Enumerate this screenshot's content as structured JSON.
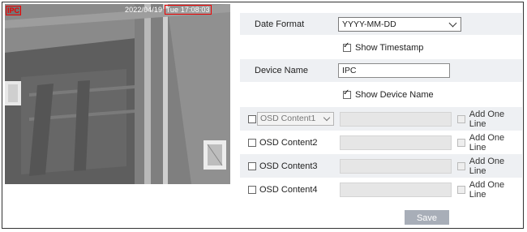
{
  "preview": {
    "osd_device_name": "IPC",
    "osd_date": "2022/04/19",
    "osd_time_boxed": "IPC",
    "osd_time": "Tue 17:08:03"
  },
  "date_format": {
    "label": "Date Format",
    "value": "YYYY-MM-DD"
  },
  "show_timestamp": {
    "label": "Show Timestamp",
    "checked": true
  },
  "device_name": {
    "label": "Device Name",
    "value": "IPC"
  },
  "show_device_name": {
    "label": "Show Device Name",
    "checked": true
  },
  "osd_rows": [
    {
      "label": "OSD Content1",
      "has_dropdown": true,
      "add_label": "Add One Line"
    },
    {
      "label": "OSD Content2",
      "has_dropdown": false,
      "add_label": "Add One Line"
    },
    {
      "label": "OSD Content3",
      "has_dropdown": false,
      "add_label": "Add One Line"
    },
    {
      "label": "OSD Content4",
      "has_dropdown": false,
      "add_label": "Add One Line"
    }
  ],
  "save_label": "Save"
}
